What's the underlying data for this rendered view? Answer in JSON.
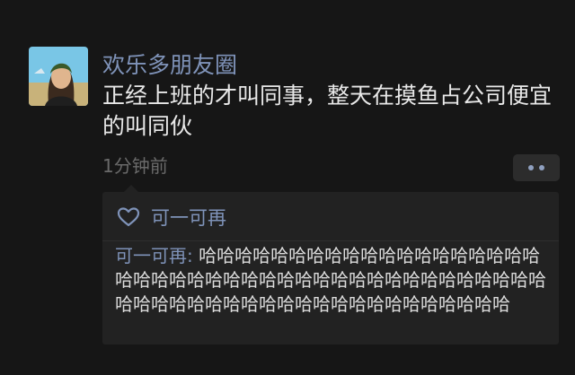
{
  "post": {
    "author": "欢乐多朋友圈",
    "text": "正经上班的才叫同事，整天在摸鱼占公司便宜的叫同伙",
    "time": "1分钟前"
  },
  "likes": {
    "names": "可一可再"
  },
  "comments": [
    {
      "author": "可一可再",
      "separator": ": ",
      "text": "哈哈哈哈哈哈哈哈哈哈哈哈哈哈哈哈哈哈哈哈哈哈哈哈哈哈哈哈哈哈哈哈哈哈哈哈哈哈哈哈哈哈哈哈哈哈哈哈哈哈哈哈哈哈哈哈哈哈哈哈哈哈哈哈哈"
    }
  ],
  "icons": {
    "like": "heart-outline-icon",
    "more": "more-dots-icon"
  },
  "colors": {
    "background": "#161616",
    "link_blue": "#7f93b9",
    "panel": "#222222"
  }
}
